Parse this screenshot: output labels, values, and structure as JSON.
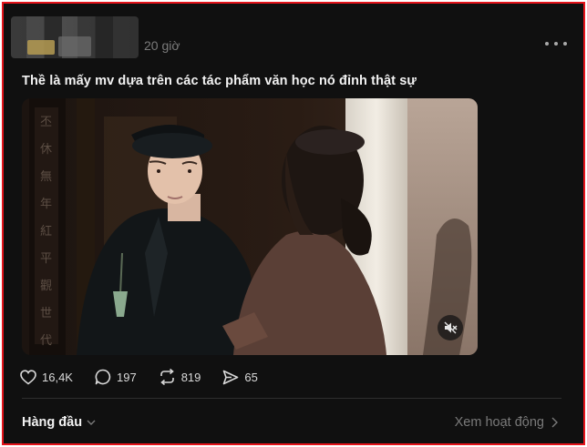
{
  "post": {
    "timestamp": "20 giờ",
    "caption": "Thề là mấy mv dựa trên các tác phẩm văn học nó đỉnh thật sự"
  },
  "video": {
    "mute_icon": "speaker-muted-icon"
  },
  "actions": {
    "likes": "16,4K",
    "comments": "197",
    "reposts": "819",
    "shares": "65"
  },
  "footer": {
    "sort_label": "Hàng đầu",
    "activity_link": "Xem hoạt động"
  },
  "colors": {
    "frame_border": "#e5141b",
    "background": "#101010",
    "muted_text": "#7a7a7a"
  }
}
